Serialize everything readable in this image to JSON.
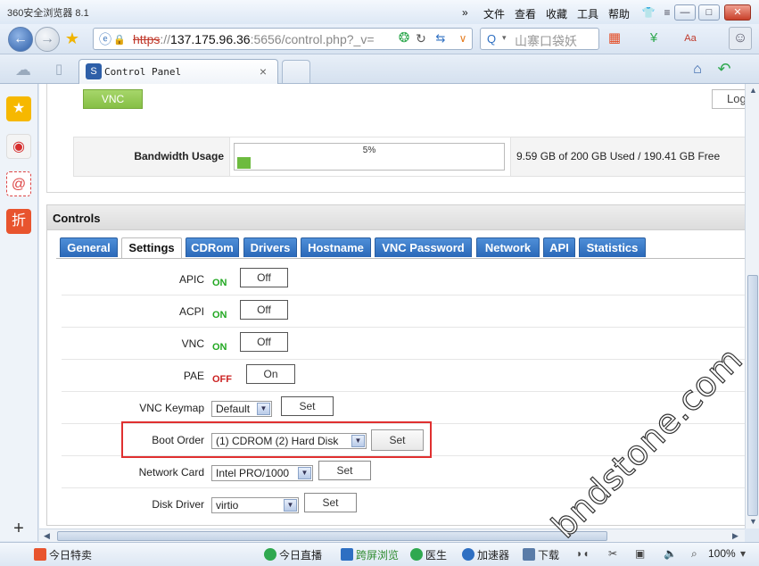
{
  "window": {
    "app_title": "360安全浏览器 8.1",
    "menus": [
      "»",
      "文件",
      "查看",
      "收藏",
      "工具",
      "帮助"
    ],
    "controls": {
      "minimize": "—",
      "restore": "□",
      "close": "✕"
    }
  },
  "address": {
    "scheme": "https",
    "host": "137.175.96.36",
    "rest": ":5656/control.php?_v=",
    "search_text": "山寨口袋妖"
  },
  "tabs": {
    "active_label": "Control Panel",
    "close": "×"
  },
  "page": {
    "vnc_button": "VNC",
    "log_button": "Log",
    "bandwidth": {
      "label": "Bandwidth Usage",
      "percent_text": "5%",
      "percent": 5,
      "summary": "9.59 GB of 200 GB Used / 190.41 GB Free"
    },
    "controls_title": "Controls",
    "tabs": [
      "General",
      "Settings",
      "CDRom",
      "Drivers",
      "Hostname",
      "VNC Password",
      "Network",
      "API",
      "Statistics"
    ],
    "active_tab": "Settings",
    "settings": {
      "apic": {
        "label": "APIC",
        "state": "ON",
        "button": "Off"
      },
      "acpi": {
        "label": "ACPI",
        "state": "ON",
        "button": "Off"
      },
      "vnc": {
        "label": "VNC",
        "state": "ON",
        "button": "Off"
      },
      "pae": {
        "label": "PAE",
        "state": "OFF",
        "button": "On"
      },
      "vnc_keymap": {
        "label": "VNC Keymap",
        "value": "Default",
        "button": "Set"
      },
      "boot_order": {
        "label": "Boot Order",
        "value": "(1) CDROM (2) Hard Disk",
        "button": "Set"
      },
      "network_card": {
        "label": "Network Card",
        "value": "Intel PRO/1000",
        "button": "Set"
      },
      "disk_driver": {
        "label": "Disk Driver",
        "value": "virtio",
        "button": "Set"
      }
    }
  },
  "watermark": "bndstone.com",
  "statusbar": {
    "today_deals": "今日特卖",
    "live": "今日直播",
    "split_browse": "跨屏浏览",
    "doctor": "医生",
    "accelerator": "加速器",
    "download": "下载",
    "zoom": "100%"
  },
  "colors": {
    "tab_blue": "#2a68b8",
    "vnc_green": "#8bc34a",
    "on_green": "#22a822",
    "off_red": "#cc2222",
    "highlight_red": "#e03030"
  }
}
